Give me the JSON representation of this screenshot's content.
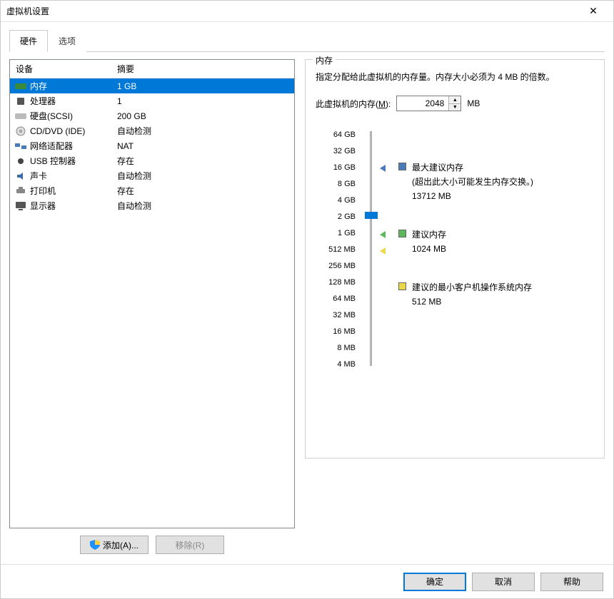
{
  "window": {
    "title": "虚拟机设置",
    "close": "✕"
  },
  "tabs": {
    "hardware": "硬件",
    "options": "选项"
  },
  "device_list": {
    "col_device": "设备",
    "col_summary": "摘要",
    "items": [
      {
        "name": "内存",
        "summary": "1 GB",
        "icon": "memory-icon"
      },
      {
        "name": "处理器",
        "summary": "1",
        "icon": "cpu-icon"
      },
      {
        "name": "硬盘(SCSI)",
        "summary": "200 GB",
        "icon": "hdd-icon"
      },
      {
        "name": "CD/DVD (IDE)",
        "summary": "自动检测",
        "icon": "cd-icon"
      },
      {
        "name": "网络适配器",
        "summary": "NAT",
        "icon": "network-icon"
      },
      {
        "name": "USB 控制器",
        "summary": "存在",
        "icon": "usb-icon"
      },
      {
        "name": "声卡",
        "summary": "自动检测",
        "icon": "sound-icon"
      },
      {
        "name": "打印机",
        "summary": "存在",
        "icon": "printer-icon"
      },
      {
        "name": "显示器",
        "summary": "自动检测",
        "icon": "display-icon"
      }
    ]
  },
  "buttons": {
    "add": "添加(A)...",
    "remove": "移除(R)",
    "ok": "确定",
    "cancel": "取消",
    "help": "帮助"
  },
  "memory_panel": {
    "group_title": "内存",
    "desc": "指定分配给此虚拟机的内存量。内存大小必须为 4 MB 的倍数。",
    "input_label_pre": "此虚拟机的内存(",
    "input_label_key": "M",
    "input_label_post": "):",
    "value": "2048",
    "unit": "MB",
    "ticks": [
      "64 GB",
      "32 GB",
      "16 GB",
      "8 GB",
      "4 GB",
      "2 GB",
      "1 GB",
      "512 MB",
      "256 MB",
      "128 MB",
      "64 MB",
      "32 MB",
      "16 MB",
      "8 MB",
      "4 MB"
    ],
    "legend": {
      "max": {
        "label": "最大建议内存",
        "note": "(超出此大小可能发生内存交换。)",
        "value": "13712 MB",
        "color": "#4a7ab8"
      },
      "rec": {
        "label": "建议内存",
        "value": "1024 MB",
        "color": "#5cb85c"
      },
      "min": {
        "label": "建议的最小客户机操作系统内存",
        "value": "512 MB",
        "color": "#e8d84a"
      }
    }
  }
}
